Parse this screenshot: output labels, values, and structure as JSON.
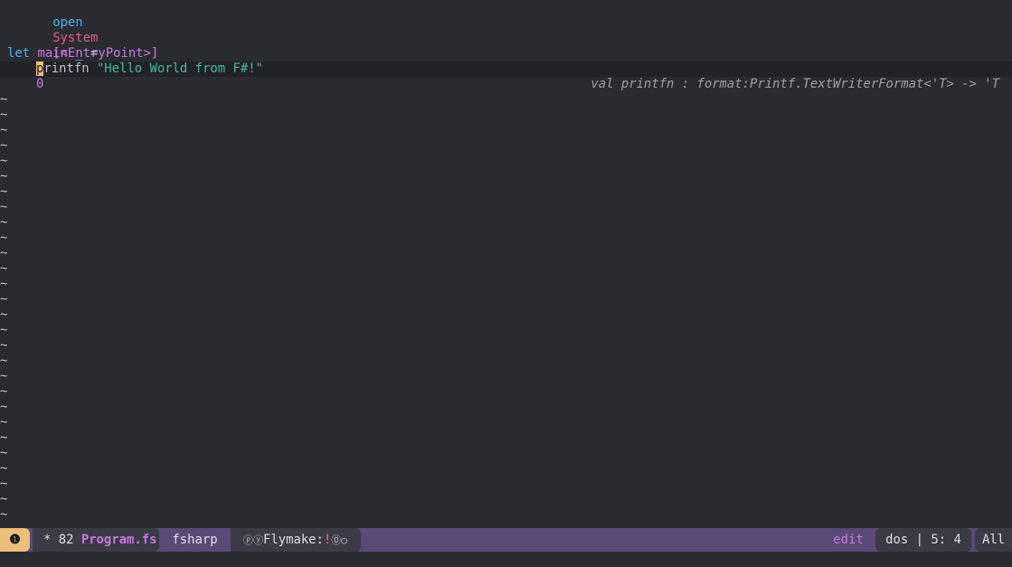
{
  "editor": {
    "line1": {
      "kw": "open",
      "ns": "System"
    },
    "line3": {
      "attr": "[<EntryPoint>]"
    },
    "line4": {
      "kw": "let",
      "fn": "main",
      "us": "_",
      "op": "="
    },
    "line5": {
      "cursor_char": "p",
      "rest": "rintfn",
      "str": "\"Hello World from F#!\""
    },
    "line6": {
      "num": "0"
    },
    "hint": "val printfn : format:Printf.TextWriterFormat<'T> -> 'T",
    "tilde": "~"
  },
  "modeline": {
    "error_indicator": "❶",
    "modified_and_size": "* 82 ",
    "filename": "Program.fs",
    "major_mode": "fsharp",
    "flymake_prefix": "ⓟⓨ",
    "flymake_label": "Flymake:",
    "flymake_bang": "!",
    "flymake_suffix": "⓪○",
    "state": "edit",
    "encoding_position": "dos | 5: 4",
    "scroll": "All"
  },
  "colors": {
    "background": "#2a2b30",
    "keyword": "#51afef",
    "namespace": "#e05d8c",
    "string": "#4db5a0",
    "purple": "#c678dd",
    "cursor": "#ecbe7b",
    "modeline": "#5a4a78"
  }
}
